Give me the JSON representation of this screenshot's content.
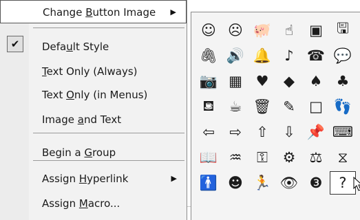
{
  "menu": {
    "items": [
      {
        "name": "change-button-image",
        "parts": [
          [
            "Change ",
            false
          ],
          [
            "B",
            true
          ],
          [
            "utton Image",
            false
          ]
        ],
        "submenu": true,
        "highlighted": true
      },
      {
        "name": "default-style",
        "parts": [
          [
            "Defa",
            false
          ],
          [
            "u",
            true
          ],
          [
            "lt Style",
            false
          ]
        ],
        "checked": true
      },
      {
        "name": "text-only-always",
        "parts": [
          [
            "T",
            true
          ],
          [
            "ext Only (Always)",
            false
          ]
        ]
      },
      {
        "name": "text-only-in-menus",
        "parts": [
          [
            "Text ",
            false
          ],
          [
            "O",
            true
          ],
          [
            "nly (in Menus)",
            false
          ]
        ]
      },
      {
        "name": "image-and-text",
        "parts": [
          [
            "Image ",
            false
          ],
          [
            "a",
            true
          ],
          [
            "nd Text",
            false
          ]
        ]
      },
      {
        "name": "begin-a-group",
        "parts": [
          [
            "Begin a ",
            false
          ],
          [
            "G",
            true
          ],
          [
            "roup",
            false
          ]
        ]
      },
      {
        "name": "assign-hyperlink",
        "parts": [
          [
            "Assign ",
            false
          ],
          [
            "H",
            true
          ],
          [
            "yperlink",
            false
          ]
        ],
        "submenu": true
      },
      {
        "name": "assign-macro",
        "parts": [
          [
            "Assign ",
            false
          ],
          [
            "M",
            true
          ],
          [
            "acro...",
            false
          ]
        ]
      }
    ],
    "submenu_arrow": "▶",
    "check_glyph": "✔"
  },
  "palette": {
    "icons": [
      {
        "name": "smiley-face-icon",
        "glyph": "☺"
      },
      {
        "name": "sad-face-icon",
        "glyph": "☹"
      },
      {
        "name": "piggy-bank-icon",
        "glyph": "🐖"
      },
      {
        "name": "hand-pointing-up-icon",
        "glyph": "☝"
      },
      {
        "name": "image-box-icon",
        "glyph": "▣"
      },
      {
        "name": "save-disk-icon",
        "glyph": "🖫"
      },
      {
        "name": "paperclip-icon",
        "glyph": "🖇"
      },
      {
        "name": "speaker-icon",
        "glyph": "🔊"
      },
      {
        "name": "bell-icon",
        "glyph": "🔔"
      },
      {
        "name": "music-note-icon",
        "glyph": "♪"
      },
      {
        "name": "telephone-icon",
        "glyph": "☎"
      },
      {
        "name": "speech-bubble-icon",
        "glyph": "💬"
      },
      {
        "name": "camera-icon",
        "glyph": "📷"
      },
      {
        "name": "calculator-icon",
        "glyph": "▦"
      },
      {
        "name": "heart-icon",
        "glyph": "♥"
      },
      {
        "name": "diamond-icon",
        "glyph": "◆"
      },
      {
        "name": "spade-icon",
        "glyph": "♠"
      },
      {
        "name": "club-icon",
        "glyph": "♣"
      },
      {
        "name": "coffee-pot-icon",
        "glyph": "⛾"
      },
      {
        "name": "mug-icon",
        "glyph": "☕"
      },
      {
        "name": "trash-can-icon",
        "glyph": "🗑"
      },
      {
        "name": "pencil-icon",
        "glyph": "✎"
      },
      {
        "name": "blank-square-icon",
        "glyph": "□"
      },
      {
        "name": "footprints-icon",
        "glyph": "👣"
      },
      {
        "name": "arrow-left-icon",
        "glyph": "⇦"
      },
      {
        "name": "arrow-right-icon",
        "glyph": "⇨"
      },
      {
        "name": "arrow-up-icon",
        "glyph": "⇧"
      },
      {
        "name": "arrow-down-icon",
        "glyph": "⇩"
      },
      {
        "name": "pushpin-icon",
        "glyph": "📌"
      },
      {
        "name": "keyboard-icon",
        "glyph": "⌨"
      },
      {
        "name": "book-icon",
        "glyph": "📖"
      },
      {
        "name": "sound-waves-icon",
        "glyph": "♒"
      },
      {
        "name": "key-icon",
        "glyph": "⚿"
      },
      {
        "name": "film-reel-icon",
        "glyph": "⚙"
      },
      {
        "name": "scales-icon",
        "glyph": "⚖"
      },
      {
        "name": "hourglass-icon",
        "glyph": "⧖"
      },
      {
        "name": "person-icon",
        "glyph": "🚹"
      },
      {
        "name": "head-profile-icon",
        "glyph": "☻"
      },
      {
        "name": "running-man-icon",
        "glyph": "🏃"
      },
      {
        "name": "eye-icon",
        "glyph": "👁"
      },
      {
        "name": "eight-ball-icon",
        "glyph": "❸"
      },
      {
        "name": "question-mark-icon",
        "glyph": "?",
        "selected": true
      }
    ]
  }
}
